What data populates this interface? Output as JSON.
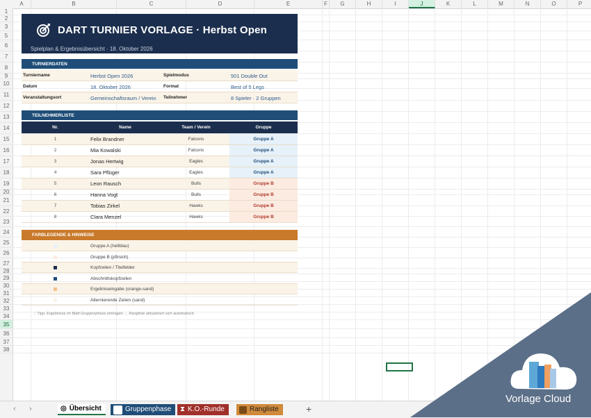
{
  "columns": [
    "A",
    "B",
    "C",
    "D",
    "E",
    "F",
    "G",
    "H",
    "I",
    "J",
    "K",
    "L",
    "M",
    "N",
    "O",
    "P"
  ],
  "selected_column": "J",
  "rows": [
    "1",
    "2",
    "3",
    "5",
    "6",
    "7",
    "8",
    "9",
    "10",
    "11",
    "12",
    "13",
    "14",
    "15",
    "16",
    "17",
    "18",
    "19",
    "20",
    "21",
    "22",
    "23",
    "24",
    "25",
    "26",
    "27",
    "28",
    "29",
    "30",
    "31",
    "32",
    "33",
    "34",
    "35",
    "36",
    "37",
    "38"
  ],
  "selected_row": "35",
  "banner": {
    "title": "DART TURNIER VORLAGE · Herbst Open",
    "subtitle": "Spielplan & Ergebnisübersicht · 18. Oktober 2026",
    "icon": "target-icon"
  },
  "turnierdaten": {
    "heading": "TURNIERDATEN",
    "rows": [
      {
        "l1": "Turniername",
        "v1": "Herbst Open 2026",
        "l2": "Spielmodus",
        "v2": "501 Double Out"
      },
      {
        "l1": "Datum",
        "v1": "18. Oktober 2026",
        "l2": "Format",
        "v2": "Best of 5 Legs"
      },
      {
        "l1": "Veranstaltungsort",
        "v1": "Gemeinschaftsraum / Verein",
        "l2": "Teilnehmer",
        "v2": "8 Spieler · 2 Gruppen"
      }
    ]
  },
  "teilnehmer": {
    "heading": "TEILNEHMERLISTE",
    "headers": [
      "Nr.",
      "Name",
      "Team / Verein",
      "Gruppe"
    ],
    "rows": [
      {
        "nr": "1",
        "name": "Felix Brandner",
        "team": "Falcons",
        "group": "Gruppe A",
        "g": "a"
      },
      {
        "nr": "2",
        "name": "Mia Kowalski",
        "team": "Falcons",
        "group": "Gruppe A",
        "g": "a"
      },
      {
        "nr": "3",
        "name": "Jonas Hertwig",
        "team": "Eagles",
        "group": "Gruppe A",
        "g": "a"
      },
      {
        "nr": "4",
        "name": "Sara Pflüger",
        "team": "Eagles",
        "group": "Gruppe A",
        "g": "a"
      },
      {
        "nr": "5",
        "name": "Leon Rausch",
        "team": "Bulls",
        "group": "Gruppe B",
        "g": "b"
      },
      {
        "nr": "6",
        "name": "Hanna Vogt",
        "team": "Bulls",
        "group": "Gruppe B",
        "g": "b"
      },
      {
        "nr": "7",
        "name": "Tobias Zirkel",
        "team": "Hawks",
        "group": "Gruppe B",
        "g": "b"
      },
      {
        "nr": "8",
        "name": "Clara Menzel",
        "team": "Hawks",
        "group": "Gruppe B",
        "g": "b"
      }
    ]
  },
  "legende": {
    "heading": "FARBLEGENDE & HINWEISE",
    "rows": [
      {
        "text": "Gruppe A (hellblau)",
        "color": "#e6f1f9"
      },
      {
        "text": "Gruppe B (pfirsich)",
        "color": "#fcebe0"
      },
      {
        "text": "Kopfzeilen / Titelfelder",
        "color": "#1b2e4d"
      },
      {
        "text": "Abschnittskopfzeilen",
        "color": "#1f4d78"
      },
      {
        "text": "Ergebniseingabe (orange-sand)",
        "color": "#f3c08a"
      },
      {
        "text": "Alternierende Zeilen (sand)",
        "color": "#faf3e8"
      }
    ]
  },
  "tip": "Tipp: Ergebnisse im Blatt Gruppenphase eintragen → Rangliste aktualisiert sich automatisch.",
  "tabs": [
    {
      "label": "Übersicht"
    },
    {
      "label": "Gruppenphase"
    },
    {
      "label": "K.O.-Runde"
    },
    {
      "label": "Rangliste"
    }
  ],
  "watermark": "Vorlage Cloud",
  "colors": {
    "navy": "#1b2e4d",
    "blue": "#1f4d78",
    "orange": "#c97a2b",
    "sand": "#faf3e8"
  }
}
